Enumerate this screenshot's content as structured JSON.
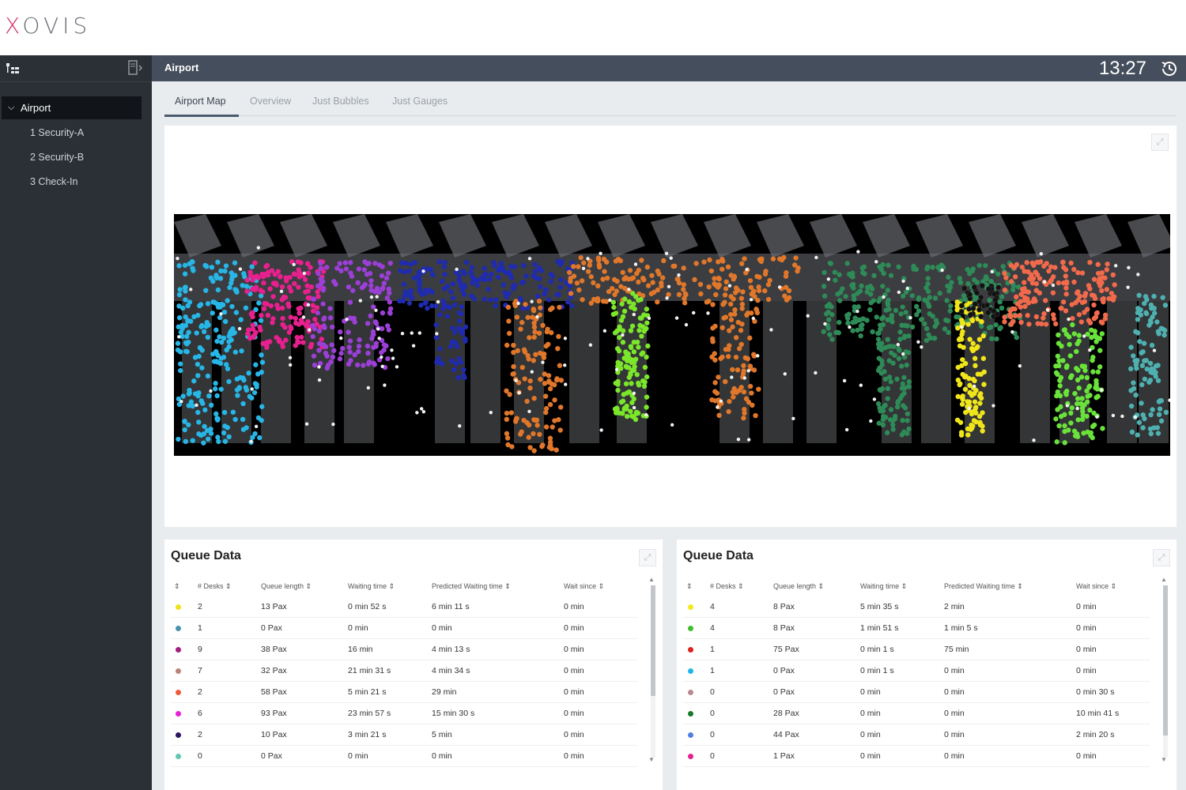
{
  "brand": {
    "logo_x": "X",
    "logo_rest": "OVIS"
  },
  "sidebar": {
    "root": "Airport",
    "items": [
      {
        "label": "1 Security-A"
      },
      {
        "label": "2 Security-B"
      },
      {
        "label": "3 Check-In"
      }
    ]
  },
  "header": {
    "title": "Airport",
    "clock": "13:27"
  },
  "tabs": [
    {
      "label": "Airport Map",
      "active": true
    },
    {
      "label": "Overview",
      "active": false
    },
    {
      "label": "Just Bubbles",
      "active": false
    },
    {
      "label": "Just Gauges",
      "active": false
    }
  ],
  "queue_left": {
    "title": "Queue Data",
    "headers": [
      "⇕",
      "# Desks ⇕",
      "Queue length ⇕",
      "Waiting time ⇕",
      "Predicted Waiting time ⇕",
      "Wait since ⇕"
    ],
    "rows": [
      {
        "color": "#f2e21b",
        "desks": "2",
        "queue": "13 Pax",
        "wait": "0 min 52 s",
        "pred": "6 min 11 s",
        "since": "0 min"
      },
      {
        "color": "#4a93a8",
        "desks": "1",
        "queue": "0 Pax",
        "wait": "0 min",
        "pred": "0 min",
        "since": "0 min"
      },
      {
        "color": "#a11e7d",
        "desks": "9",
        "queue": "38 Pax",
        "wait": "16 min",
        "pred": "4 min 13 s",
        "since": "0 min"
      },
      {
        "color": "#b88578",
        "desks": "7",
        "queue": "32 Pax",
        "wait": "21 min 31 s",
        "pred": "4 min 34 s",
        "since": "0 min"
      },
      {
        "color": "#f05a3a",
        "desks": "2",
        "queue": "58 Pax",
        "wait": "5 min 21 s",
        "pred": "29 min",
        "since": "0 min"
      },
      {
        "color": "#e81fd6",
        "desks": "6",
        "queue": "93 Pax",
        "wait": "23 min 57 s",
        "pred": "15 min 30 s",
        "since": "0 min"
      },
      {
        "color": "#2a1560",
        "desks": "2",
        "queue": "10 Pax",
        "wait": "3 min 21 s",
        "pred": "5 min",
        "since": "0 min"
      },
      {
        "color": "#62c7b0",
        "desks": "0",
        "queue": "0 Pax",
        "wait": "0 min",
        "pred": "0 min",
        "since": "0 min"
      }
    ]
  },
  "queue_right": {
    "title": "Queue Data",
    "headers": [
      "⇕",
      "# Desks ⇕",
      "Queue length ⇕",
      "Waiting time ⇕",
      "Predicted Waiting time ⇕",
      "Wait since ⇕"
    ],
    "rows": [
      {
        "color": "#f2ea1b",
        "desks": "4",
        "queue": "8 Pax",
        "wait": "5 min 35 s",
        "pred": "2 min",
        "since": "0 min"
      },
      {
        "color": "#3fbf2f",
        "desks": "4",
        "queue": "8 Pax",
        "wait": "1 min 51 s",
        "pred": "1 min 5 s",
        "since": "0 min"
      },
      {
        "color": "#e0201f",
        "desks": "1",
        "queue": "75 Pax",
        "wait": "0 min 1 s",
        "pred": "75 min",
        "since": "0 min"
      },
      {
        "color": "#22b5e8",
        "desks": "1",
        "queue": "0 Pax",
        "wait": "0 min 1 s",
        "pred": "0 min",
        "since": "0 min"
      },
      {
        "color": "#b88a95",
        "desks": "0",
        "queue": "0 Pax",
        "wait": "0 min",
        "pred": "0 min",
        "since": "0 min 30 s"
      },
      {
        "color": "#1a7a2a",
        "desks": "0",
        "queue": "28 Pax",
        "wait": "0 min",
        "pred": "0 min",
        "since": "10 min 41 s"
      },
      {
        "color": "#4f7fe0",
        "desks": "0",
        "queue": "44 Pax",
        "wait": "0 min",
        "pred": "0 min",
        "since": "2 min 20 s"
      },
      {
        "color": "#e8208e",
        "desks": "0",
        "queue": "1 Pax",
        "wait": "0 min",
        "pred": "0 min",
        "since": "0 min"
      }
    ]
  },
  "map": {
    "zones": [
      {
        "color": "#27b6e6"
      },
      {
        "color": "#e8208e"
      },
      {
        "color": "#9b3fd6"
      },
      {
        "color": "#1f2bb0"
      },
      {
        "color": "#e0772a"
      },
      {
        "color": "#7be62a"
      },
      {
        "color": "#e0772a"
      },
      {
        "color": "#2e8b57"
      },
      {
        "color": "#f0e51a"
      },
      {
        "color": "#f26a4c"
      },
      {
        "color": "#69e33a"
      },
      {
        "color": "#4fb0b0"
      }
    ]
  }
}
